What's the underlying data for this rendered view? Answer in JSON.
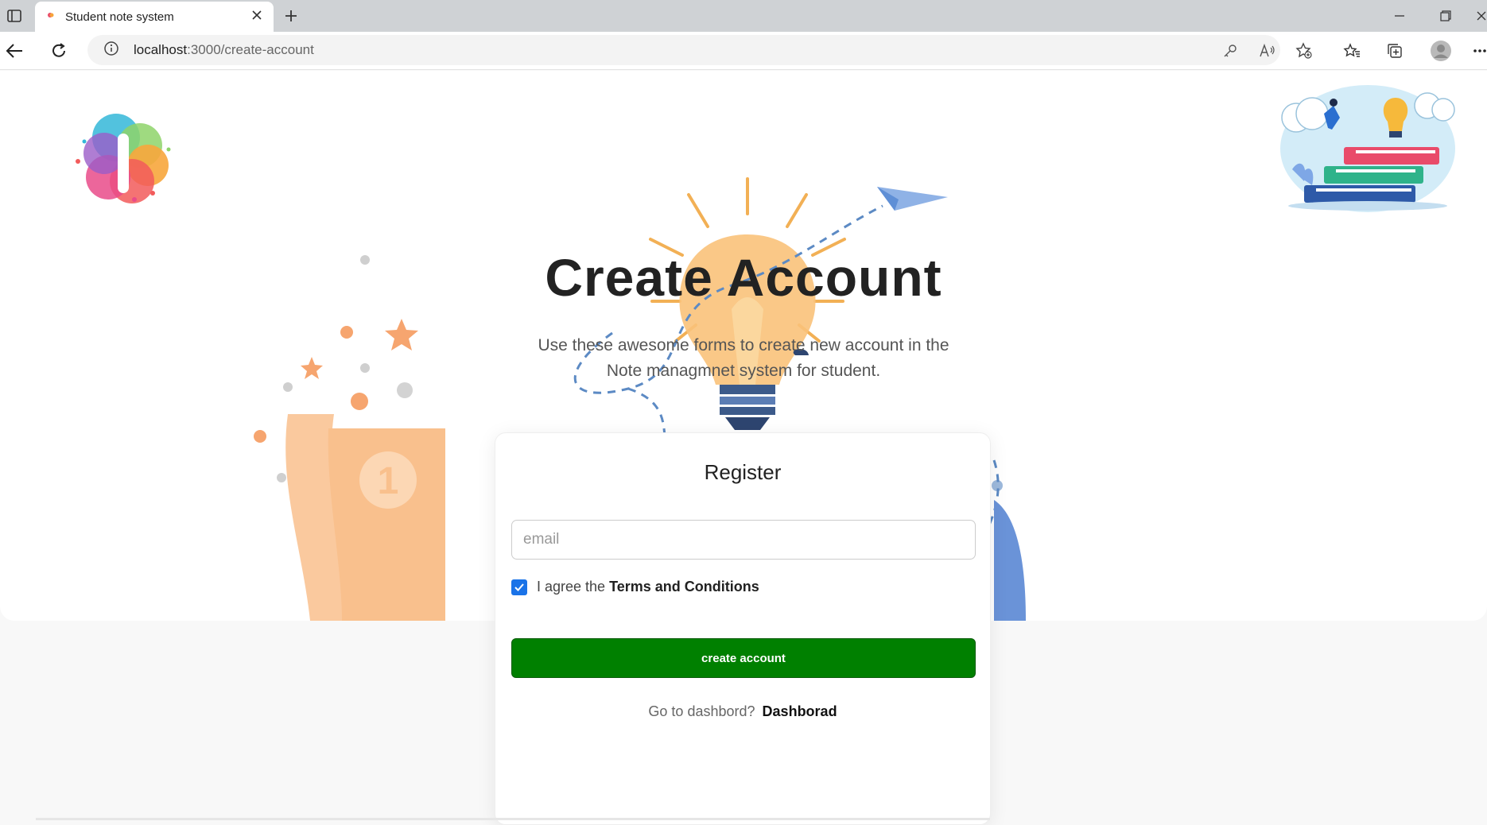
{
  "browser": {
    "tab_title": "Student note system",
    "url_host": "localhost",
    "url_path": ":3000/create-account"
  },
  "hero": {
    "title": "Create Account",
    "subtitle": "Use these awesome forms to create new account in the Note managmnet system for student."
  },
  "form": {
    "title": "Register",
    "email_placeholder": "email",
    "email_value": "",
    "agree_prefix": "I agree the",
    "terms_label": "Terms and Conditions",
    "terms_checked": true,
    "submit_label": "create account",
    "goto_prefix": "Go to dashbord?",
    "goto_link": "Dashborad"
  },
  "colors": {
    "submit_bg": "#008000",
    "checkbox": "#1a73e8",
    "bulb": "#f6b45a",
    "trophy": "#f9c08d"
  }
}
